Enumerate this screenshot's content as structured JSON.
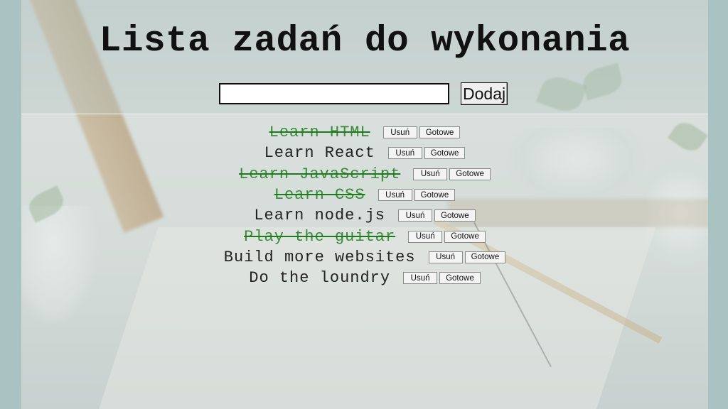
{
  "header": {
    "title": "Lista zadań do wykonania"
  },
  "form": {
    "input_value": "",
    "add_label": "Dodaj"
  },
  "todos": [
    {
      "text": "Learn HTML",
      "done": true,
      "remove_label": "Usuń",
      "done_label": "Gotowe"
    },
    {
      "text": "Learn React",
      "done": false,
      "remove_label": "Usuń",
      "done_label": "Gotowe"
    },
    {
      "text": "Learn JavaScript",
      "done": true,
      "remove_label": "Usuń",
      "done_label": "Gotowe"
    },
    {
      "text": "Learn CSS",
      "done": true,
      "remove_label": "Usuń",
      "done_label": "Gotowe"
    },
    {
      "text": "Learn node.js",
      "done": false,
      "remove_label": "Usuń",
      "done_label": "Gotowe"
    },
    {
      "text": "Play the guitar",
      "done": true,
      "remove_label": "Usuń",
      "done_label": "Gotowe"
    },
    {
      "text": "Build more websites",
      "done": false,
      "remove_label": "Usuń",
      "done_label": "Gotowe"
    },
    {
      "text": "Do the loundry",
      "done": false,
      "remove_label": "Usuń",
      "done_label": "Gotowe"
    }
  ],
  "colors": {
    "done_text": "#3a8a3a",
    "strike": "#1e7a1e",
    "side_background": "#a9c2c2"
  }
}
